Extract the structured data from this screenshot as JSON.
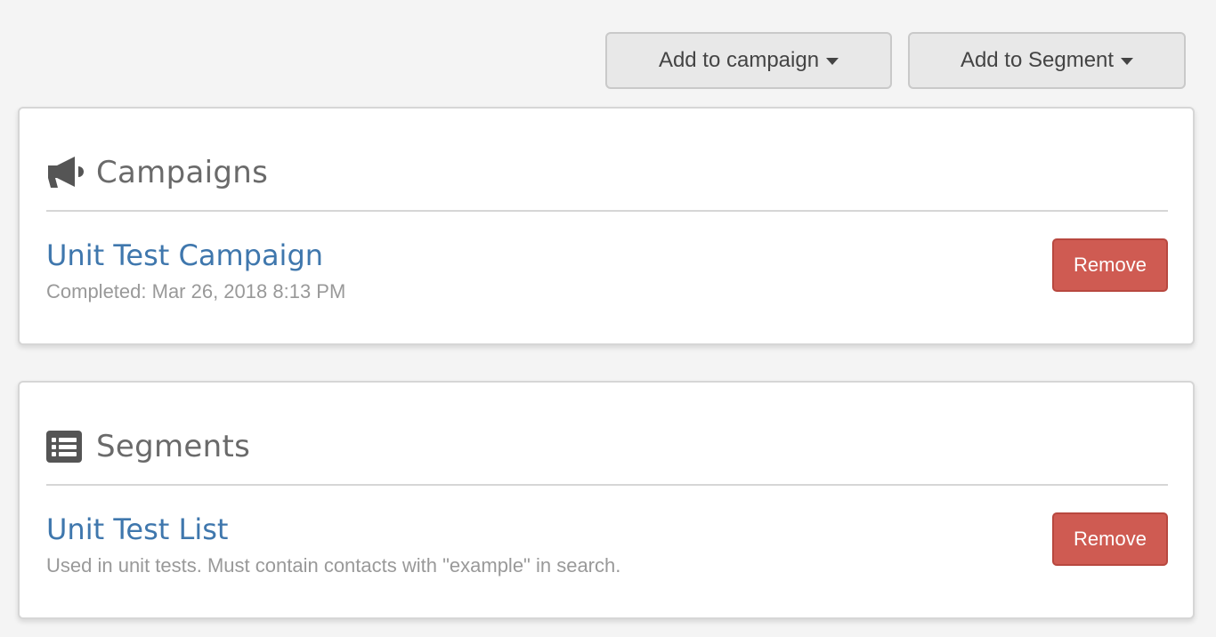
{
  "toolbar": {
    "add_to_campaign_label": "Add to campaign",
    "add_to_segment_label": "Add to Segment"
  },
  "campaigns": {
    "title": "Campaigns",
    "icon": "bullhorn-icon",
    "items": [
      {
        "title": "Unit Test Campaign",
        "meta": "Completed: Mar 26, 2018 8:13 PM",
        "remove_label": "Remove"
      }
    ]
  },
  "segments": {
    "title": "Segments",
    "icon": "list-icon",
    "items": [
      {
        "title": "Unit Test List",
        "meta": "Used in unit tests. Must contain contacts with \"example\" in search.",
        "remove_label": "Remove"
      }
    ]
  },
  "colors": {
    "background": "#f4f4f4",
    "link": "#3f77ad",
    "danger": "#cf5b52",
    "muted_text": "#999999",
    "heading": "#6a6a6a"
  }
}
